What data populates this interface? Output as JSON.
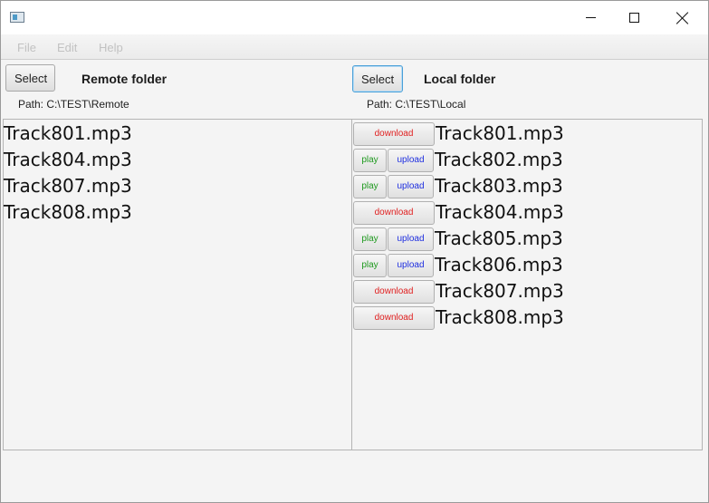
{
  "window": {
    "title": ""
  },
  "menu": {
    "file": "File",
    "edit": "Edit",
    "help": "Help"
  },
  "remote": {
    "select_label": "Select",
    "title": "Remote folder",
    "path": "Path: C:\\TEST\\Remote",
    "tracks": [
      "Track801.mp3",
      "Track804.mp3",
      "Track807.mp3",
      "Track808.mp3"
    ]
  },
  "local": {
    "select_label": "Select",
    "title": "Local folder",
    "path": "Path: C:\\TEST\\Local",
    "download_label": "download",
    "play_label": "play",
    "upload_label": "upload",
    "tracks": [
      {
        "name": "Track801.mp3",
        "kind": "download"
      },
      {
        "name": "Track802.mp3",
        "kind": "local"
      },
      {
        "name": "Track803.mp3",
        "kind": "local"
      },
      {
        "name": "Track804.mp3",
        "kind": "download"
      },
      {
        "name": "Track805.mp3",
        "kind": "local"
      },
      {
        "name": "Track806.mp3",
        "kind": "local"
      },
      {
        "name": "Track807.mp3",
        "kind": "download"
      },
      {
        "name": "Track808.mp3",
        "kind": "download"
      }
    ]
  },
  "colors": {
    "download": "#e02020",
    "play": "#1f9a1f",
    "upload": "#1f2fe0",
    "select_focus": "#4aa0d8"
  }
}
